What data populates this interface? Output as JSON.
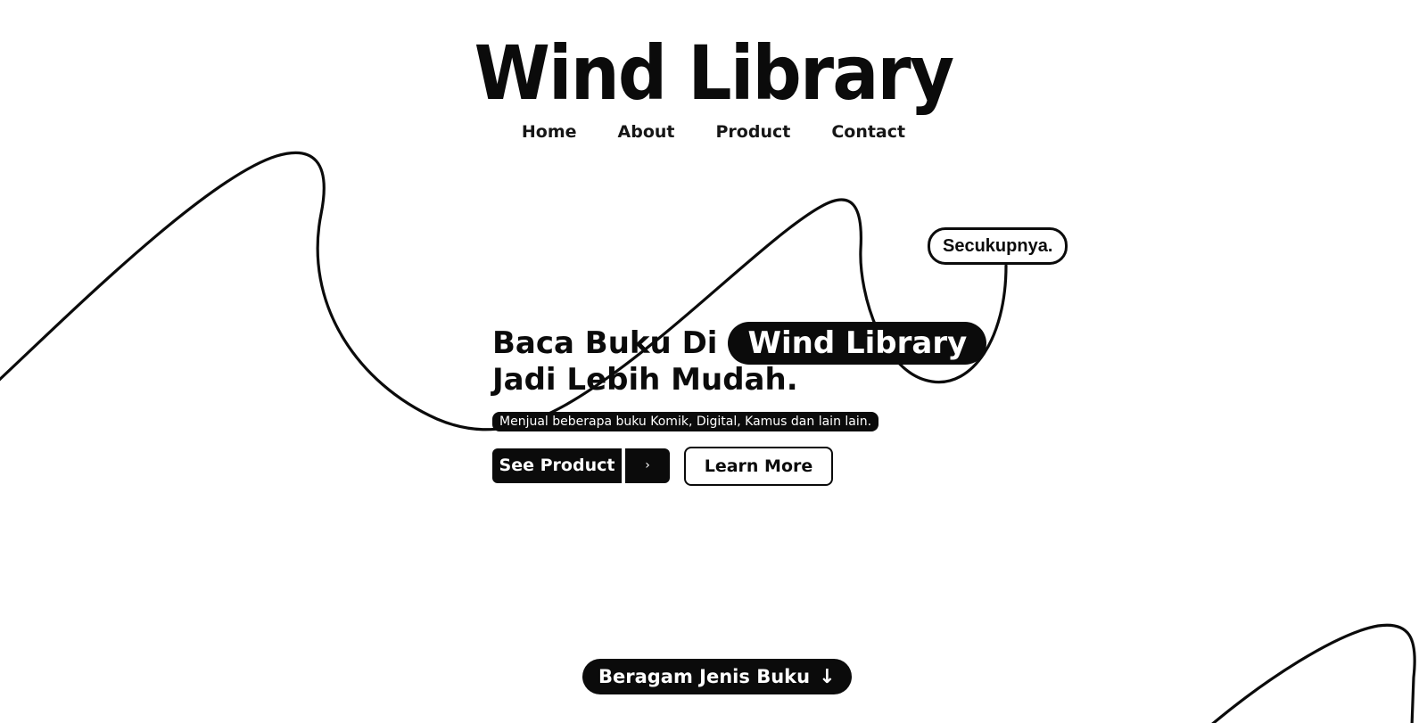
{
  "brand": {
    "logo_text": "Wind Library"
  },
  "nav": {
    "items": [
      {
        "label": "Home"
      },
      {
        "label": "About"
      },
      {
        "label": "Product"
      },
      {
        "label": "Contact"
      }
    ]
  },
  "hero": {
    "tag": "Secukupnya.",
    "title_prefix": "Baca Buku Di",
    "title_highlight": "Wind Library",
    "title_line2": "Jadi Lebih Mudah.",
    "subtitle": "Menjual beberapa buku Komik, Digital, Kamus dan lain lain.",
    "primary_button": "See Product",
    "primary_arrow": "›",
    "secondary_button": "Learn More"
  },
  "section": {
    "label": "Beragam Jenis Buku",
    "icon": "arrow-down-icon",
    "icon_glyph": "↓"
  },
  "colors": {
    "ink": "#0b0b0b",
    "background": "#ffffff"
  }
}
